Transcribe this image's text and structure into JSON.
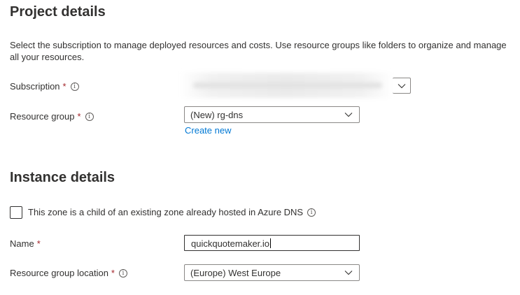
{
  "project": {
    "heading": "Project details",
    "description": "Select the subscription to manage deployed resources and costs. Use resource groups like folders to organize and manage all your resources.",
    "subscription": {
      "label": "Subscription",
      "required_mark": "*",
      "info_glyph": "i",
      "value": ""
    },
    "resource_group": {
      "label": "Resource group",
      "required_mark": "*",
      "info_glyph": "i",
      "value": "(New) rg-dns",
      "create_new_link": "Create new"
    }
  },
  "instance": {
    "heading": "Instance details",
    "child_zone_checkbox": {
      "label": "This zone is a child of an existing zone already hosted in Azure DNS",
      "info_glyph": "i",
      "checked": false
    },
    "name": {
      "label": "Name",
      "required_mark": "*",
      "value": "quickquotemaker.io"
    },
    "location": {
      "label": "Resource group location",
      "required_mark": "*",
      "info_glyph": "i",
      "value": "(Europe) West Europe"
    }
  },
  "colors": {
    "required": "#a4262c",
    "link": "#0078d4",
    "text": "#323130",
    "border": "#8a8886"
  },
  "icons": {
    "info": "info-icon",
    "dropdown": "chevron-down-icon"
  }
}
